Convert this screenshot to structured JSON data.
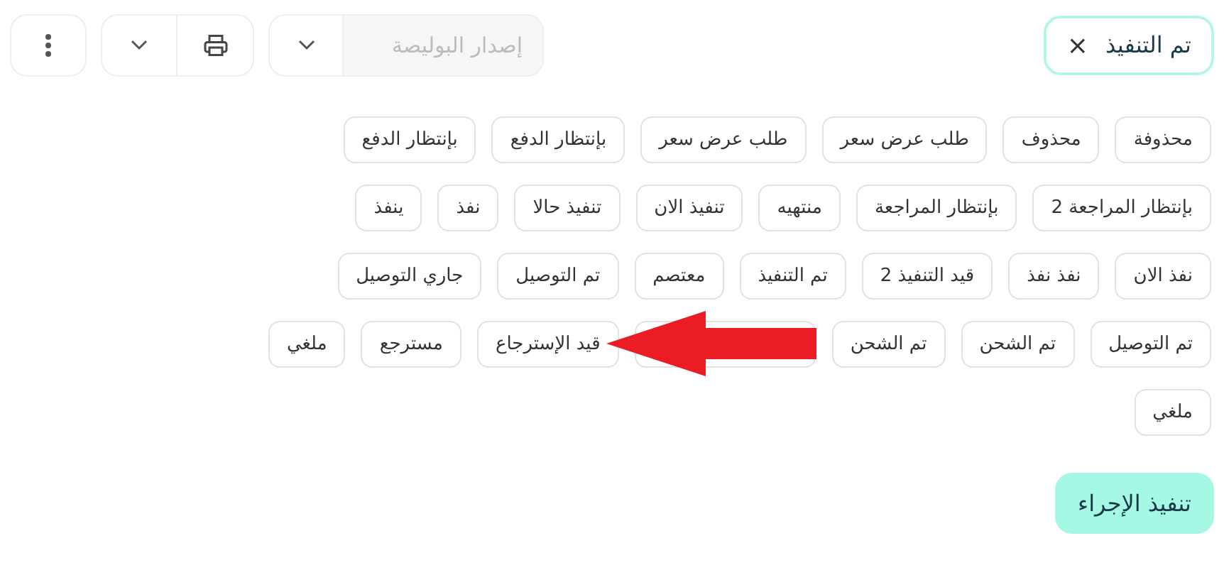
{
  "toolbar": {
    "filter_chip": {
      "label": "تم التنفيذ",
      "close": "×"
    },
    "policy_field": {
      "placeholder": "إصدار البوليصة",
      "disabled": true
    }
  },
  "status_chip_rows": [
    [
      {
        "kind": "chip",
        "label": "محذوفة"
      },
      {
        "kind": "chip",
        "label": "محذوف"
      },
      {
        "kind": "chip",
        "label": "طلب عرض سعر"
      },
      {
        "kind": "chip",
        "label": "طلب عرض سعر"
      },
      {
        "kind": "chip",
        "label": "بإنتظار الدفع"
      },
      {
        "kind": "chip",
        "label": "بإنتظار الدفع"
      }
    ],
    [
      {
        "kind": "chip",
        "label": "بإنتظار المراجعة 2"
      },
      {
        "kind": "chip",
        "label": "بإنتظار المراجعة"
      },
      {
        "kind": "chip",
        "label": "منتهيه"
      },
      {
        "kind": "chip",
        "label": "تنفيذ الان"
      },
      {
        "kind": "chip",
        "label": "تنفيذ حالا"
      },
      {
        "kind": "chip",
        "label": "نفذ"
      },
      {
        "kind": "chip",
        "label": "ينفذ"
      }
    ],
    [
      {
        "kind": "chip",
        "label": "نفذ الان"
      },
      {
        "kind": "chip",
        "label": "نفذ نفذ"
      },
      {
        "kind": "chip",
        "label": "قيد التنفيذ 2"
      },
      {
        "kind": "chip",
        "label": "تم التنفيذ"
      },
      {
        "kind": "chip",
        "label": "معتصم"
      },
      {
        "kind": "chip",
        "label": "تم التوصيل"
      },
      {
        "kind": "chip",
        "label": "جاري التوصيل"
      }
    ],
    [
      {
        "kind": "chip",
        "label": "تم التوصيل"
      },
      {
        "kind": "chip",
        "label": "تم الشحن"
      },
      {
        "kind": "chip",
        "label": "تم الشحن"
      },
      {
        "kind": "covered"
      },
      {
        "kind": "chip",
        "label": "قيد الإسترجاع"
      },
      {
        "kind": "chip",
        "label": "مسترجع"
      },
      {
        "kind": "chip",
        "label": "ملغي"
      }
    ],
    [
      {
        "kind": "chip",
        "label": "ملغي"
      }
    ]
  ],
  "action_button": {
    "label": "تنفيذ الإجراء"
  }
}
